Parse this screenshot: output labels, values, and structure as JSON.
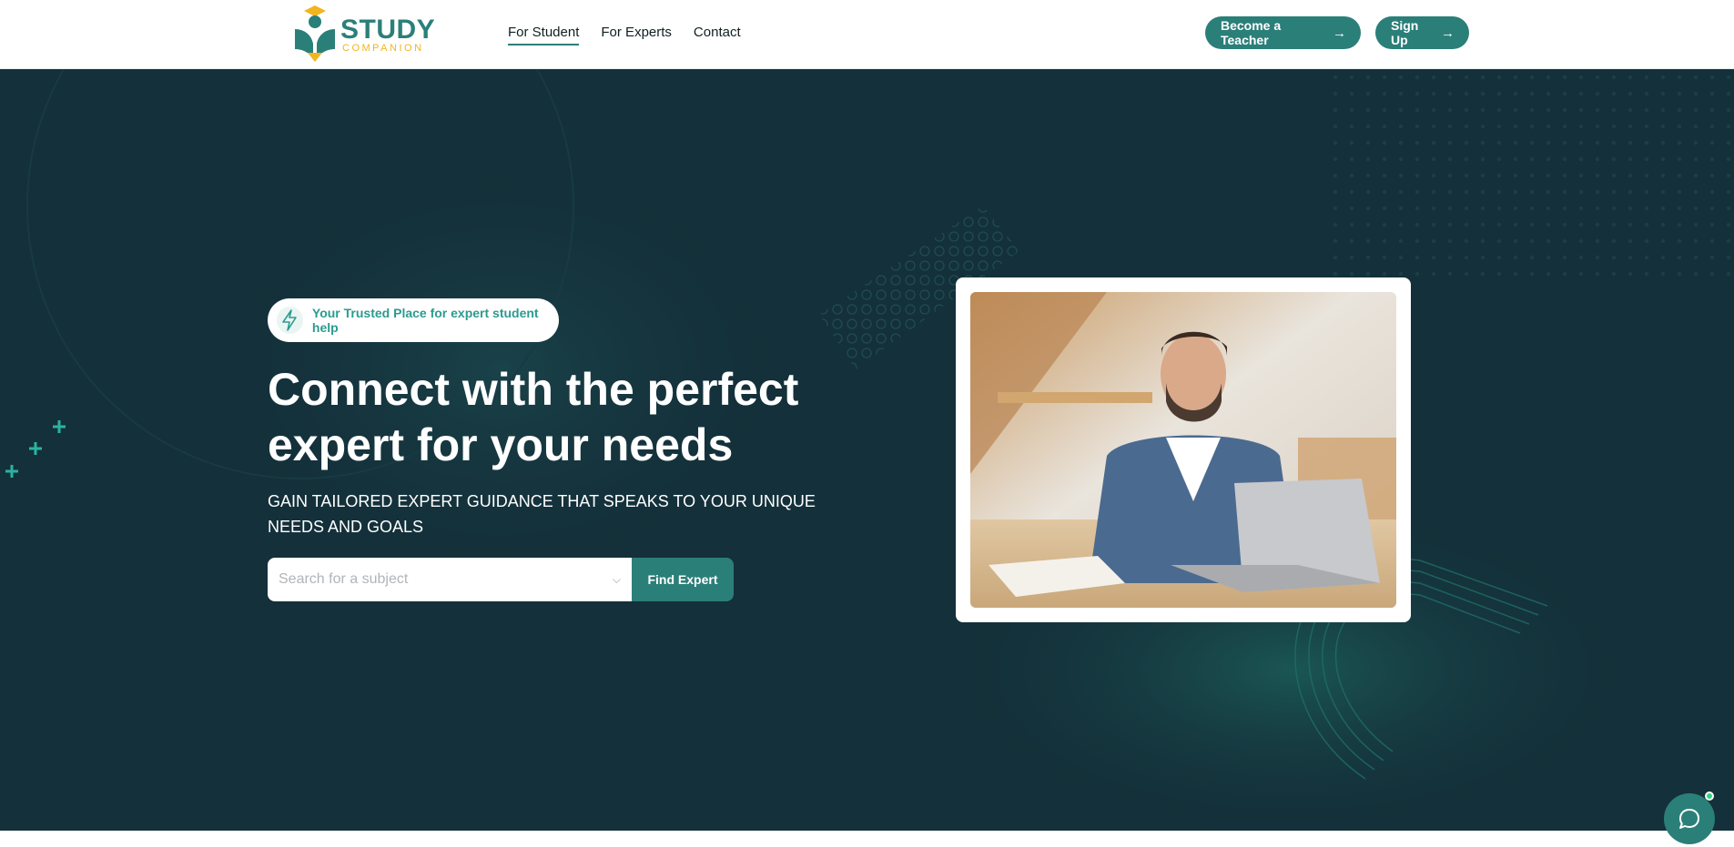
{
  "brand": {
    "name_primary": "STUDY",
    "name_secondary": "COMPANION",
    "primary_color": "#2b7f79",
    "accent_color": "#f2b41f",
    "hero_bg_color": "#14303a"
  },
  "nav": {
    "items": [
      {
        "label": "For Student",
        "active": true
      },
      {
        "label": "For Experts",
        "active": false
      },
      {
        "label": "Contact",
        "active": false
      }
    ]
  },
  "header_buttons": {
    "become_teacher": "Become a Teacher",
    "sign_up": "Sign Up",
    "arrow_icon": "arrow-right-icon"
  },
  "hero": {
    "badge_icon": "lightning-icon",
    "badge_text": "Your Trusted Place for expert student help",
    "headline": "Connect with the perfect expert for your needs",
    "subheadline": "GAIN TAILORED EXPERT GUIDANCE THAT SPEAKS TO YOUR UNIQUE NEEDS AND GOALS",
    "search_placeholder": "Search for a subject",
    "search_value": "",
    "find_button": "Find Expert"
  },
  "chat": {
    "icon": "chat-bubble-icon",
    "online": true
  }
}
